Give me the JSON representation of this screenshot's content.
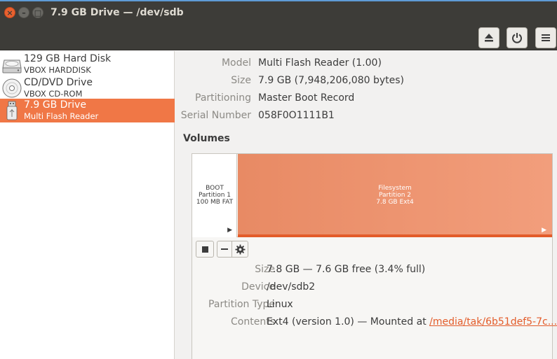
{
  "window": {
    "title": "7.9 GB Drive — /dev/sdb",
    "close_glyph": "×",
    "minimize_glyph": "–",
    "maximize_glyph": "□"
  },
  "header": {
    "eject_icon": "eject-icon",
    "power_icon": "power-icon",
    "menu_icon": "menu-icon"
  },
  "sidebar": {
    "drives": [
      {
        "name": "129 GB Hard Disk",
        "sub": "VBOX HARDDISK",
        "icon": "harddisk-icon",
        "selected": false
      },
      {
        "name": "CD/DVD Drive",
        "sub": "VBOX CD-ROM",
        "icon": "optical-disc-icon",
        "selected": false
      },
      {
        "name": "7.9 GB Drive",
        "sub": "Multi Flash Reader",
        "icon": "usb-drive-icon",
        "selected": true
      }
    ]
  },
  "drive_info": {
    "model_label": "Model",
    "model_value": "Multi Flash Reader (1.00)",
    "size_label": "Size",
    "size_value": "7.9 GB (7,948,206,080 bytes)",
    "partitioning_label": "Partitioning",
    "partitioning_value": "Master Boot Record",
    "serial_label": "Serial Number",
    "serial_value": "058F0O1111B1"
  },
  "volumes": {
    "title": "Volumes",
    "partitions": [
      {
        "line1": "BOOT",
        "line2": "Partition 1",
        "line3": "100 MB FAT"
      },
      {
        "line1": "Filesystem",
        "line2": "Partition 2",
        "line3": "7.8 GB Ext4"
      }
    ],
    "toolbar": {
      "stop_icon": "stop-icon",
      "minus_icon": "minus-icon",
      "gear_icon": "gear-icon"
    },
    "details": {
      "size_label": "Size",
      "size_value": "7.8 GB — 7.6 GB free (3.4% full)",
      "device_label": "Device",
      "device_value": "/dev/sdb2",
      "ptype_label": "Partition Type",
      "ptype_value": "Linux",
      "contents_label": "Contents",
      "contents_prefix": "Ext4 (version 1.0) — Mounted at ",
      "contents_link": "/media/tak/6b51def5-7c..."
    }
  },
  "colors": {
    "accent": "#f07746",
    "titlebar": "#3d3c38",
    "link": "#e35c2a"
  }
}
